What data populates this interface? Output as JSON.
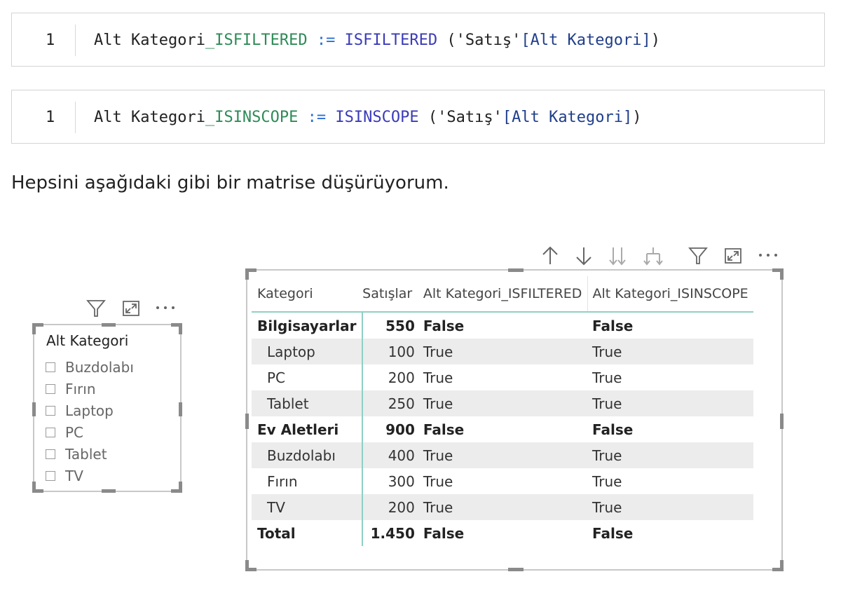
{
  "code_blocks": [
    {
      "line_number": "1",
      "name": "Alt Kategori",
      "suffix": "_ISFILTERED",
      "operator": ":=",
      "function": "ISFILTERED",
      "open": "(",
      "table": "'Satış'",
      "column": "[Alt Kategori]",
      "close": ")"
    },
    {
      "line_number": "1",
      "name": "Alt Kategori",
      "suffix": "_ISINSCOPE",
      "operator": ":=",
      "function": "ISINSCOPE",
      "open": "(",
      "table": "'Satış'",
      "column": "[Alt Kategori]",
      "close": ")"
    }
  ],
  "paragraph": "Hepsini aşağıdaki gibi bir matrise düşürüyorum.",
  "slicer": {
    "title": "Alt Kategori",
    "items": [
      "Buzdolabı",
      "Fırın",
      "Laptop",
      "PC",
      "Tablet",
      "TV"
    ]
  },
  "matrix": {
    "headers": [
      "Kategori",
      "Satışlar",
      "Alt Kategori_ISFILTERED",
      "Alt Kategori_ISINSCOPE"
    ],
    "rows": [
      {
        "c": [
          "Bilgisayarlar",
          "550",
          "False",
          "False"
        ],
        "bold": true,
        "indent": false
      },
      {
        "c": [
          "Laptop",
          "100",
          "True",
          "True"
        ],
        "bold": false,
        "indent": true
      },
      {
        "c": [
          "PC",
          "200",
          "True",
          "True"
        ],
        "bold": false,
        "indent": true
      },
      {
        "c": [
          "Tablet",
          "250",
          "True",
          "True"
        ],
        "bold": false,
        "indent": true
      },
      {
        "c": [
          "Ev Aletleri",
          "900",
          "False",
          "False"
        ],
        "bold": true,
        "indent": false
      },
      {
        "c": [
          "Buzdolabı",
          "400",
          "True",
          "True"
        ],
        "bold": false,
        "indent": true
      },
      {
        "c": [
          "Fırın",
          "300",
          "True",
          "True"
        ],
        "bold": false,
        "indent": true
      },
      {
        "c": [
          "TV",
          "200",
          "True",
          "True"
        ],
        "bold": false,
        "indent": true
      },
      {
        "c": [
          "Total",
          "1.450",
          "False",
          "False"
        ],
        "bold": true,
        "indent": false
      }
    ]
  },
  "icons": {
    "matrix_toolbar": [
      "arrow-up-icon",
      "arrow-down-icon",
      "double-arrow-down-icon",
      "expand-hierarchy-icon",
      "filter-icon",
      "focus-mode-icon",
      "more-options-icon"
    ],
    "slicer_toolbar": [
      "filter-icon",
      "focus-mode-icon",
      "more-options-icon"
    ]
  },
  "colors": {
    "code_suffix": "#2e8b57",
    "code_function": "#3b3bb8",
    "code_operator": "#2b6fd6",
    "matrix_accent": "#8fd0c4"
  }
}
